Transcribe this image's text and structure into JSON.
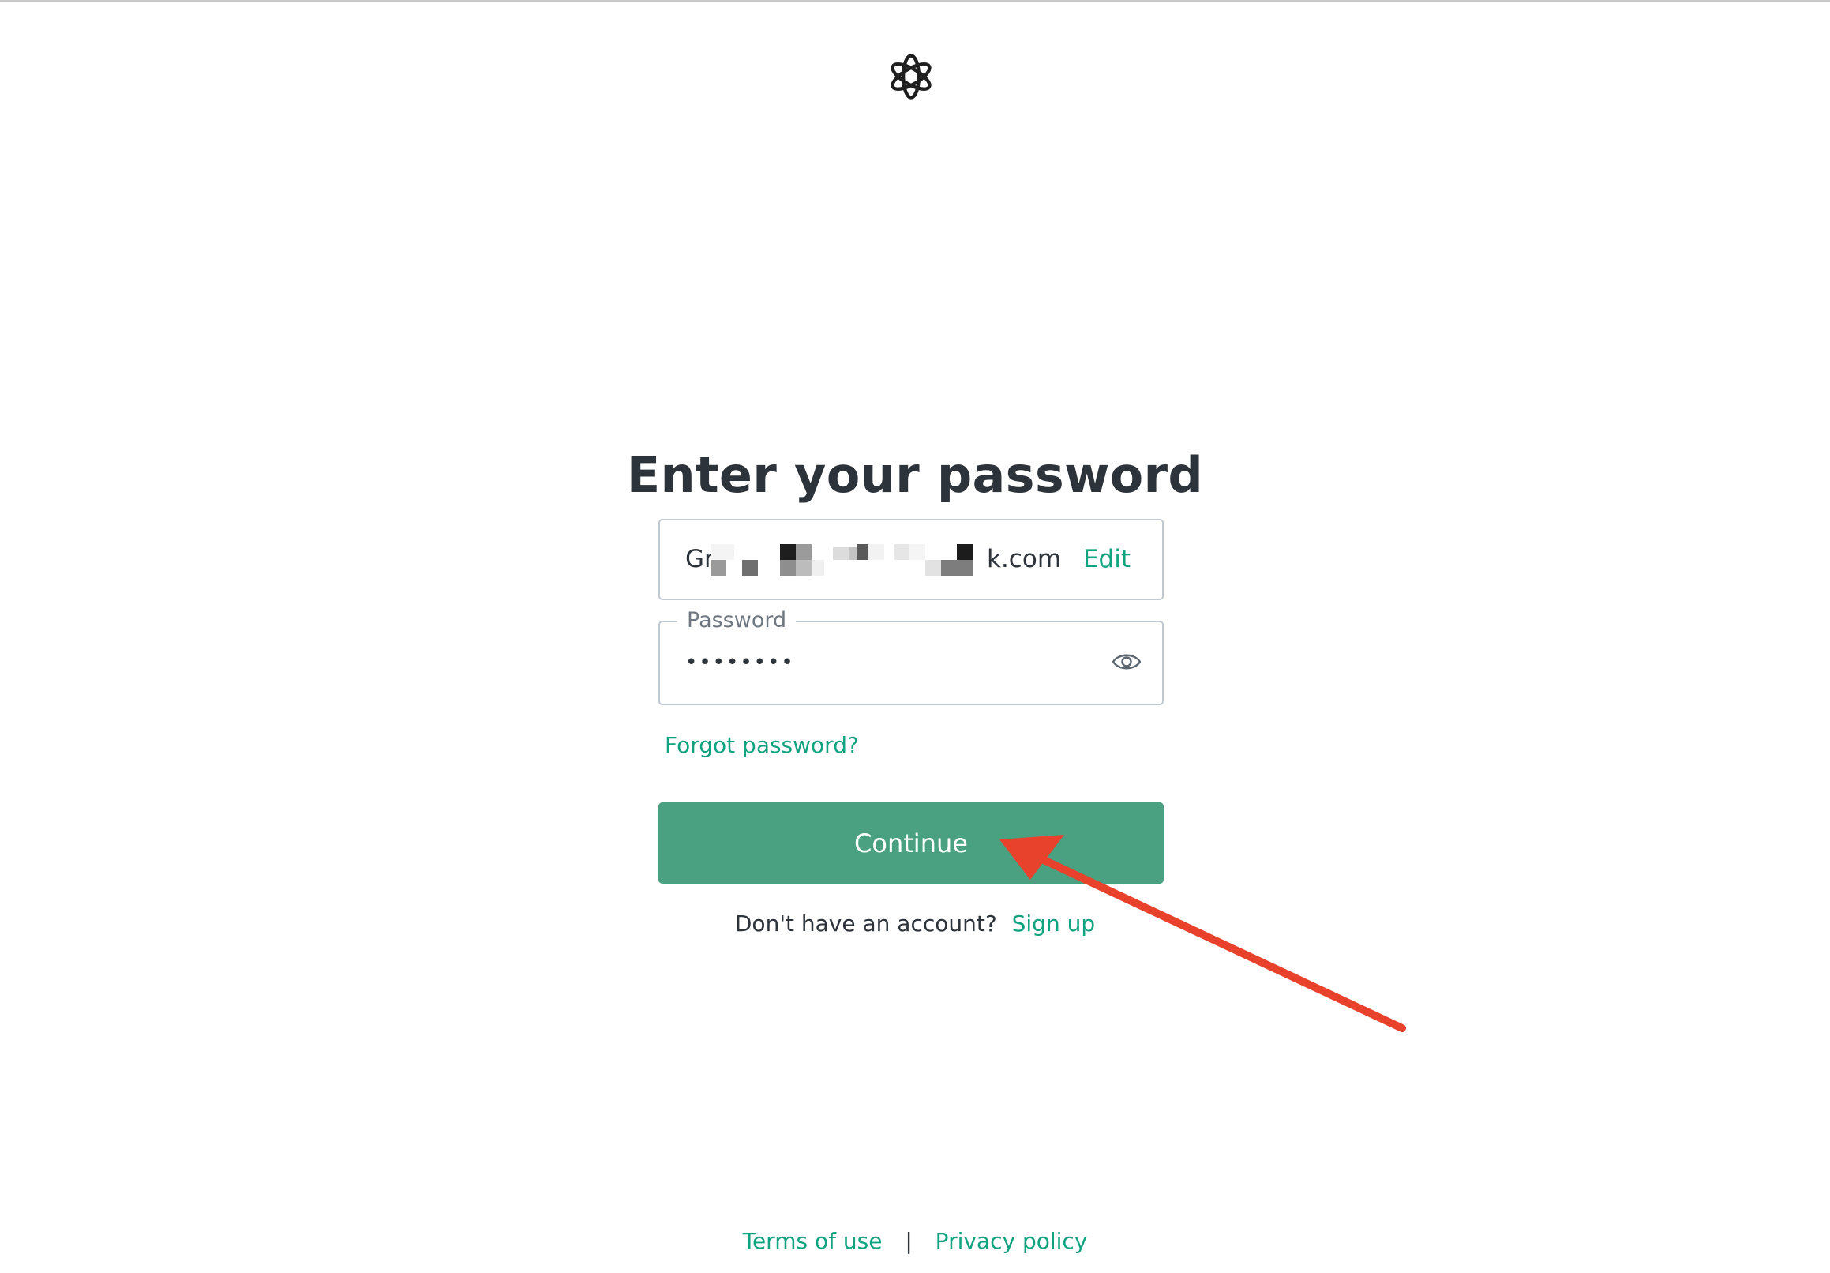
{
  "logo": {
    "icon": "openai-logo-icon"
  },
  "page": {
    "title": "Enter your password"
  },
  "email_field": {
    "value_prefix": "Gr",
    "value_suffix": "k.com",
    "edit_label": "Edit"
  },
  "password_field": {
    "label": "Password",
    "value_masked": "••••••••",
    "toggle_icon": "eye-icon"
  },
  "links": {
    "forgot_password": "Forgot password?"
  },
  "actions": {
    "continue_label": "Continue"
  },
  "signup": {
    "prompt": "Don't have an account?",
    "link": "Sign up"
  },
  "footer": {
    "terms": "Terms of use",
    "separator": "|",
    "privacy": "Privacy policy"
  },
  "colors": {
    "accent": "#10a37f",
    "button": "#4aa181",
    "annotation": "#e8412c"
  }
}
